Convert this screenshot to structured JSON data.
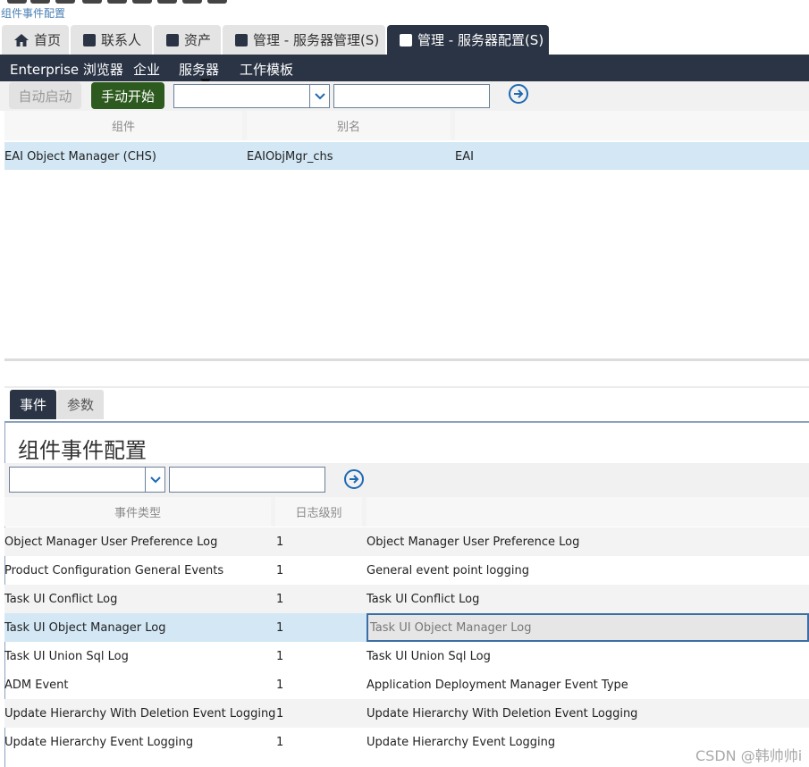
{
  "breadcrumb": "组件事件配置",
  "tabs": [
    {
      "label": "首页",
      "icon": "home-icon"
    },
    {
      "label": "联系人",
      "icon": "square-icon"
    },
    {
      "label": "资产",
      "icon": "square-icon"
    },
    {
      "label": "管理 - 服务器管理(S)",
      "icon": "square-icon"
    },
    {
      "label": "管理 - 服务器配置(S)",
      "icon": "square-outline-icon",
      "active": true
    }
  ],
  "nav": {
    "items": [
      "Enterprise 浏览器",
      "企业",
      "服务器",
      "工作模板"
    ],
    "active": "服务器"
  },
  "toolbar1": {
    "auto_start_label": "自动启动",
    "manual_start_label": "手动开始",
    "query_select_value": "",
    "query_input_value": ""
  },
  "components_grid": {
    "columns": [
      "组件",
      "别名",
      ""
    ],
    "rows": [
      {
        "component": "EAI Object Manager (CHS)",
        "alias": "EAIObjMgr_chs",
        "extra": "EAI",
        "selected": true
      }
    ]
  },
  "subtabs": [
    {
      "label": "事件",
      "active": true
    },
    {
      "label": "参数",
      "active": false
    }
  ],
  "events_panel": {
    "title": "组件事件配置",
    "query_select_value": "",
    "query_input_value": "",
    "columns": [
      "事件类型",
      "日志级别",
      ""
    ],
    "rows": [
      {
        "type": "Object Manager User Preference Log",
        "level": "1",
        "desc": "Object Manager User Preference Log"
      },
      {
        "type": "Product Configuration General Events",
        "level": "1",
        "desc": "General event point logging"
      },
      {
        "type": "Task UI Conflict Log",
        "level": "1",
        "desc": "Task UI Conflict Log"
      },
      {
        "type": "Task UI Object Manager Log",
        "level": "1",
        "desc": "Task UI Object Manager Log",
        "selected": true
      },
      {
        "type": "Task UI Union Sql Log",
        "level": "1",
        "desc": "Task UI Union Sql Log"
      },
      {
        "type": "ADM Event",
        "level": "1",
        "desc": "Application Deployment Manager Event Type"
      },
      {
        "type": "Update Hierarchy With Deletion Event Logging",
        "level": "1",
        "desc": "Update Hierarchy With Deletion Event Logging"
      },
      {
        "type": "Update Hierarchy Event Logging",
        "level": "1",
        "desc": "Update Hierarchy Event Logging"
      }
    ]
  },
  "watermark": "CSDN @韩帅帅i",
  "colors": {
    "nav_bg": "#2b3445",
    "green_button": "#2d5a1e",
    "selected_row": "#d3e7f5",
    "link_blue": "#1f69b3"
  }
}
